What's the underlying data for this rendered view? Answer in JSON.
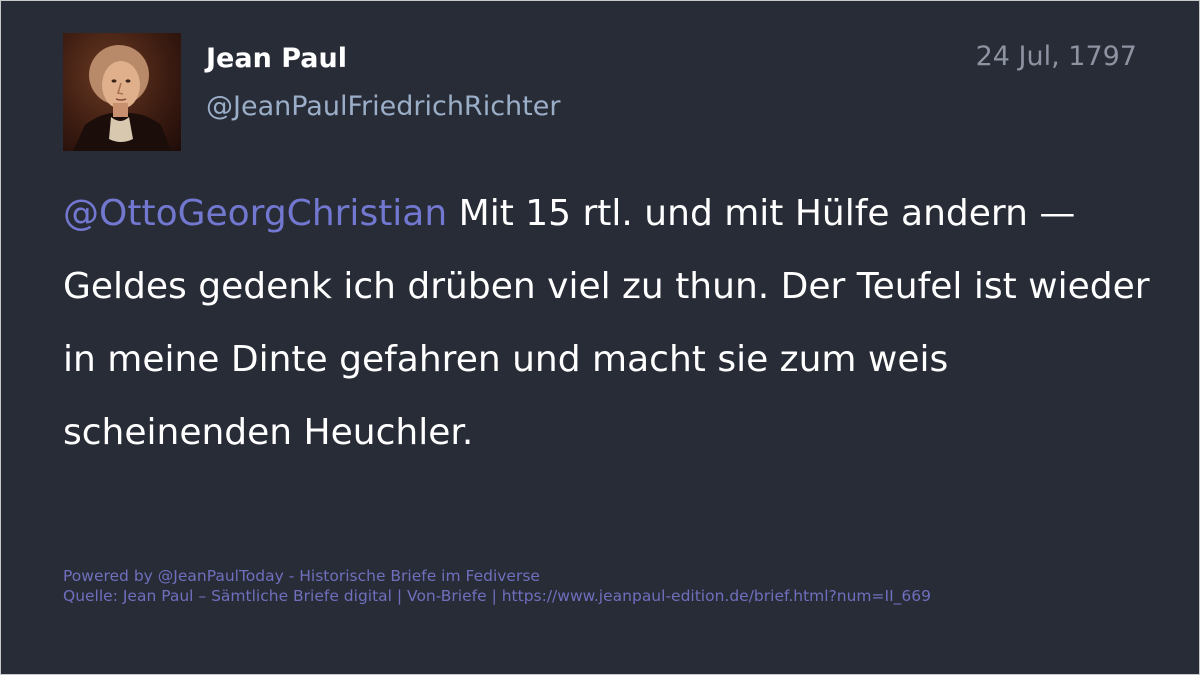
{
  "post": {
    "author_name": "Jean Paul",
    "author_handle": "@JeanPaulFriedrichRichter",
    "date": "24 Jul, 1797",
    "mention": "@OttoGeorgChristian",
    "text": " Mit 15 rtl. und mit Hülfe andern — Geldes gedenk ich drüben viel zu thun. Der Teufel ist wieder in meine Dinte gefahren und macht sie zum weis scheinenden Heuchler."
  },
  "footer": {
    "powered_by": "Powered by @JeanPaulToday - Historische Briefe im Fediverse",
    "source": "Quelle: Jean Paul – Sämtliche Briefe digital | Von-Briefe | https://www.jeanpaul-edition.de/brief.html?num=II_669"
  },
  "colors": {
    "background": "#282c37",
    "mention": "#7278d0",
    "handle": "#9baec8",
    "date": "#8d93a1",
    "footer": "#6f6fbd"
  },
  "icons": {
    "avatar": "portrait-avatar"
  }
}
